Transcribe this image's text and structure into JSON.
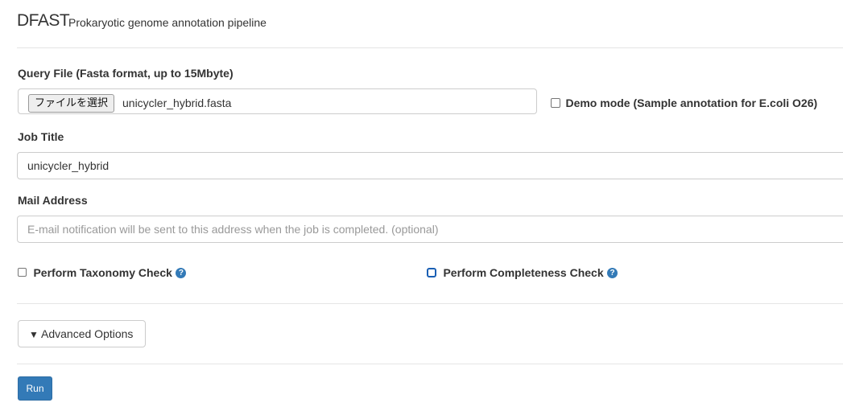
{
  "header": {
    "brand": "DFAST",
    "tagline": "Prokaryotic genome annotation pipeline"
  },
  "query_file": {
    "label": "Query File (Fasta format, up to 15Mbyte)",
    "button_label": "ファイルを選択",
    "file_name": "unicycler_hybrid.fasta"
  },
  "demo_mode": {
    "label": "Demo mode (Sample annotation for E.coli O26)",
    "checked": false
  },
  "job_title": {
    "label": "Job Title",
    "value": "unicycler_hybrid"
  },
  "mail": {
    "label": "Mail Address",
    "placeholder": "E-mail notification will be sent to this address when the job is completed. (optional)"
  },
  "checks": {
    "taxonomy_label": "Perform Taxonomy Check",
    "completeness_label": "Perform Completeness Check",
    "help_glyph": "?"
  },
  "advanced": {
    "arrow": "▼",
    "label": "Advanced Options"
  },
  "run": {
    "label": "Run"
  },
  "colors": {
    "primary": "#337ab7",
    "border": "#cccccc",
    "text": "#333333"
  }
}
